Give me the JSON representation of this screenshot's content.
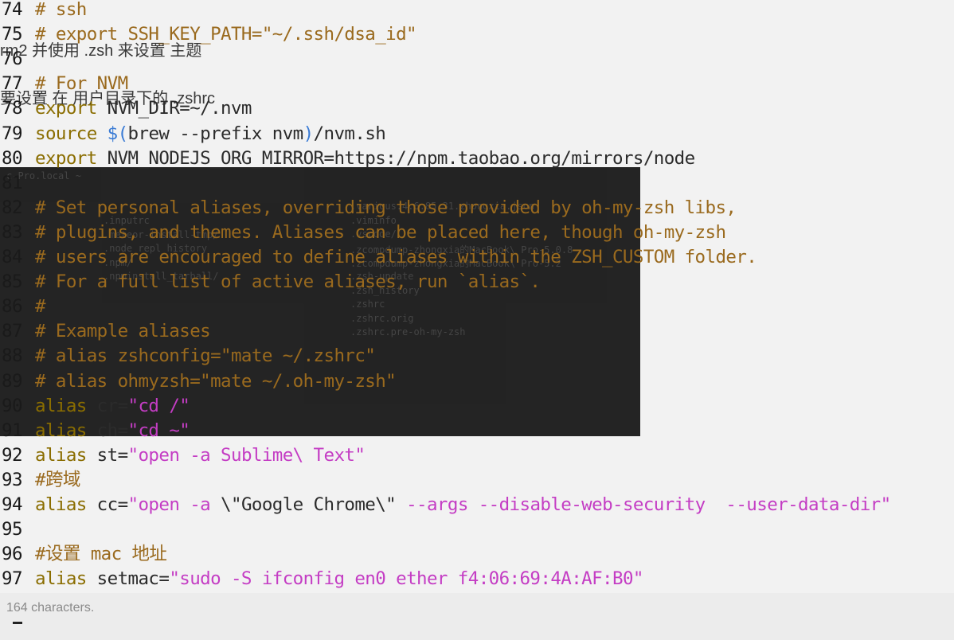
{
  "background_text": {
    "line_a": "rm2 并使用 .zsh 来设置 主题",
    "line_b": "要设置 在 用户目录下的 .zshrc"
  },
  "terminal_overlay": {
    "prompt": "c-Pro.local ~",
    "left_column": [
      ".inputrc",
      ".meteor-install-tmp/",
      ".node_repl_history",
      ".npm/",
      ".npminstall_tarball/"
    ],
    "right_column": [
      ".various.4.6.85.31.zhongxia.json",
      ".viminfo",
      ".vscode/",
      ".zcompdump-zhongxia的MacBook\\ Pro-5.0.8",
      ".zcompdump-zhongxia的MacBook\\ Pro-5.2",
      ".zsh-update",
      ".zsh_history",
      ".zshrc",
      ".zshrc.orig",
      ".zshrc.pre-oh-my-zsh"
    ]
  },
  "status_bar": {
    "text": "164 characters."
  },
  "colors": {
    "keyword": "#8a6d00",
    "comment": "#9a6a1e",
    "string": "#c43dc4",
    "variable": "#3a7bd5"
  },
  "code_lines": [
    {
      "n": "74",
      "parts": [
        [
          "cmt",
          "# ssh"
        ]
      ]
    },
    {
      "n": "75",
      "parts": [
        [
          "cmt",
          "# export SSH_KEY_PATH=\"~/.ssh/dsa_id\""
        ]
      ]
    },
    {
      "n": "76",
      "parts": []
    },
    {
      "n": "77",
      "parts": [
        [
          "cmt",
          "# For NVM"
        ]
      ]
    },
    {
      "n": "78",
      "parts": [
        [
          "kw",
          "export"
        ],
        [
          "plain",
          " NVM_DIR=~/.nvm"
        ]
      ]
    },
    {
      "n": "79",
      "parts": [
        [
          "kw",
          "source"
        ],
        [
          "plain",
          " "
        ],
        [
          "var",
          "$("
        ],
        [
          "plain",
          "brew --prefix nvm"
        ],
        [
          "var",
          ")"
        ],
        [
          "plain",
          "/nvm.sh"
        ]
      ]
    },
    {
      "n": "80",
      "parts": [
        [
          "kw",
          "export"
        ],
        [
          "plain",
          " NVM_NODEJS_ORG_MIRROR=https://npm.taobao.org/mirrors/node"
        ]
      ]
    },
    {
      "n": "81",
      "parts": []
    },
    {
      "n": "82",
      "parts": [
        [
          "cmt",
          "# Set personal aliases, overriding those provided by oh-my-zsh libs,"
        ]
      ]
    },
    {
      "n": "83",
      "parts": [
        [
          "cmt",
          "# plugins, and themes. Aliases can be placed here, though oh-my-zsh"
        ]
      ]
    },
    {
      "n": "84",
      "parts": [
        [
          "cmt",
          "# users are encouraged to define aliases within the ZSH_CUSTOM folder."
        ]
      ]
    },
    {
      "n": "85",
      "parts": [
        [
          "cmt",
          "# For a full list of active aliases, run `alias`."
        ]
      ]
    },
    {
      "n": "86",
      "parts": [
        [
          "cmt",
          "#"
        ]
      ]
    },
    {
      "n": "87",
      "parts": [
        [
          "cmt",
          "# Example aliases"
        ]
      ]
    },
    {
      "n": "88",
      "parts": [
        [
          "cmt",
          "# alias zshconfig=\"mate ~/.zshrc\""
        ]
      ]
    },
    {
      "n": "89",
      "parts": [
        [
          "cmt",
          "# alias ohmyzsh=\"mate ~/.oh-my-zsh\""
        ]
      ]
    },
    {
      "n": "90",
      "parts": [
        [
          "kw",
          "alias"
        ],
        [
          "plain",
          " cr="
        ],
        [
          "str",
          "\"cd /\""
        ]
      ]
    },
    {
      "n": "91",
      "parts": [
        [
          "kw",
          "alias"
        ],
        [
          "plain",
          " ch="
        ],
        [
          "str",
          "\"cd ~\""
        ]
      ]
    },
    {
      "n": "92",
      "parts": [
        [
          "kw",
          "alias"
        ],
        [
          "plain",
          " st="
        ],
        [
          "str",
          "\"open -a Sublime\\ Text\""
        ]
      ]
    },
    {
      "n": "93",
      "parts": [
        [
          "cmt",
          "#跨域"
        ]
      ]
    },
    {
      "n": "94",
      "parts": [
        [
          "kw",
          "alias"
        ],
        [
          "plain",
          " cc="
        ],
        [
          "str",
          "\"open -a "
        ],
        [
          "plain",
          "\\\"Google Chrome\\\""
        ],
        [
          "str",
          " --args --disable-web-security  --user-data-dir\""
        ]
      ]
    },
    {
      "n": "95",
      "parts": []
    },
    {
      "n": "96",
      "parts": [
        [
          "cmt",
          "#设置 mac 地址"
        ]
      ]
    },
    {
      "n": "97",
      "parts": [
        [
          "kw",
          "alias"
        ],
        [
          "plain",
          " setmac="
        ],
        [
          "str",
          "\"sudo -S ifconfig en0 ether f4:06:69:4A:AF:B0\""
        ]
      ]
    },
    {
      "n": "98",
      "parts": []
    }
  ]
}
